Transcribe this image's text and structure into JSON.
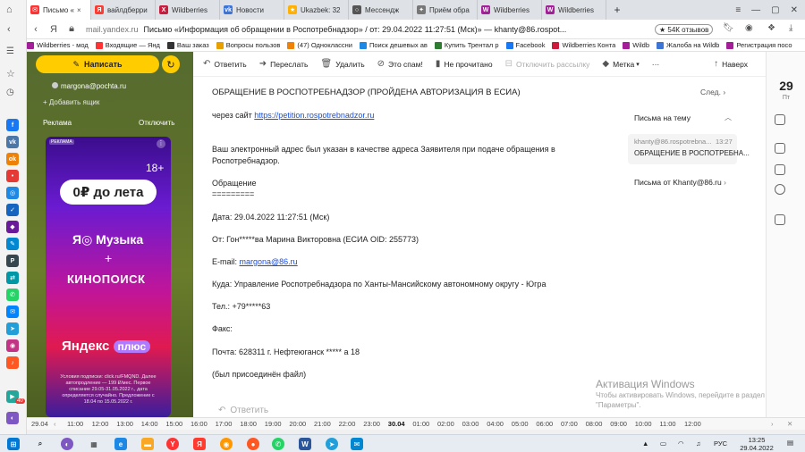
{
  "tabs": [
    {
      "label": "Письмо «",
      "color": "#ff3333",
      "icon": "mail-icon",
      "active": true
    },
    {
      "label": "вайлдберри",
      "color": "#ff3b30",
      "icon": "yandex-icon"
    },
    {
      "label": "Wildberries",
      "color": "#cb1b3c",
      "icon": "wb-icon"
    },
    {
      "label": "Новости",
      "color": "#3d75d6",
      "icon": "vk-icon"
    },
    {
      "label": "Ukazbek: 32",
      "color": "#ffb000",
      "icon": "ukazbek-icon"
    },
    {
      "label": "Мессендж",
      "color": "#555555",
      "icon": "messenger-icon"
    },
    {
      "label": "Приём обра",
      "color": "#777777",
      "icon": "gov-icon"
    },
    {
      "label": "Wildberries",
      "color": "#a31e98",
      "icon": "wb-icon"
    },
    {
      "label": "Wildberries",
      "color": "#a31e98",
      "icon": "wb-icon"
    }
  ],
  "address": {
    "host": "mail.yandex.ru",
    "title": "Письмо «Информация об обращении в Роспотребнадзор» / от: 29.04.2022 11:27:51 (Мск)» — khanty@86.rospot...",
    "reviews": "★ 54К отзывов"
  },
  "bookmarks": [
    {
      "label": "Wildberries - мод",
      "color": "#a31e98"
    },
    {
      "label": "Входящие — Янд",
      "color": "#ff3333"
    },
    {
      "label": "Ваш заказ",
      "color": "#333333"
    },
    {
      "label": "Вопросы пользов",
      "color": "#e8a000"
    },
    {
      "label": "(47) Одноклассни",
      "color": "#ee8208"
    },
    {
      "label": "Поиск дешевых ав",
      "color": "#1e88e5"
    },
    {
      "label": "Купить Трентал р",
      "color": "#2e7d32"
    },
    {
      "label": "Facebook",
      "color": "#1877f2"
    },
    {
      "label": "Wildberries Конта",
      "color": "#cb1b3c"
    },
    {
      "label": "Wildb",
      "color": "#a31e98"
    },
    {
      "label": "Жалоба на Wildb",
      "color": "#3d75d6"
    },
    {
      "label": "Регистрация посо",
      "color": "#a31e98"
    }
  ],
  "sidebar_left": {
    "email": "margona@pochta.ru",
    "add_box": "Добавить ящик",
    "ad_label": "Реклама",
    "ad_off": "Отключить"
  },
  "ad": {
    "badge": "РЕКЛАМА",
    "age": "18+",
    "promo": "0₽ до лета",
    "music": "Музыка",
    "plus": "+",
    "kino": "КИНОПОИСК",
    "yandex": "Яндекс",
    "plus_word": "плюс",
    "fine_print": "Условия подписки: click.ru/FMQND. Далее автопродление — 199 ₽/мес. Первое списание 29.05-31.05.2022 г., дата определяется случайно. Предложение с 18.04 по 15.05.2022 г."
  },
  "compose": {
    "label": "Написать"
  },
  "toolbar": {
    "reply": "Ответить",
    "forward": "Переслать",
    "delete": "Удалить",
    "spam": "Это спам!",
    "unread": "Не прочитано",
    "unsubscribe": "Отключить рассылку",
    "label": "Метка",
    "more": "···",
    "up": "Наверх"
  },
  "message": {
    "subject": "ОБРАЩЕНИЕ В РОСПОТРЕБНАДЗОР (ПРОЙДЕНА АВТОРИЗАЦИЯ В ЕСИА)",
    "next": "След.",
    "via_prefix": "через сайт ",
    "via_link": "https://petition.rospotrebnadzor.ru",
    "notice_1": "Ваш электронный адрес был указан в качестве адреса Заявителя при подаче обращения в",
    "notice_2": "Роспотребнадзор.",
    "section": "Обращение",
    "rule": "=========",
    "date": "Дата: 29.04.2022 11:27:51 (Мск)",
    "from": "От: Гон*****ва Марина Викторовна (ЕСИА OID: 255773)",
    "email_prefix": "E-mail: ",
    "email_link": "margona@86.ru",
    "to": "Куда: Управление Роспотребнадзора по Ханты-Мансийскому автономному округу - Югра",
    "phone": "Тел.: +79*****63",
    "fax": "Факс:",
    "post": "Почта: 628311 г. Нефтеюганск ***** а 18",
    "attachment": "(был присоединён файл)"
  },
  "thread": {
    "title": "Письма на тему",
    "item_from": "khanty@86.rospotrebna...",
    "item_time": "13:27",
    "item_subject": "ОБРАЩЕНИЕ В РОСПОТРЕБНА...",
    "from_khanty": "Письма от Khanty@86.ru"
  },
  "rail": {
    "day": "29",
    "weekday": "Пт"
  },
  "reply_bar": {
    "label": "Ответить"
  },
  "watermark": {
    "line1": "Активация Windows",
    "line2": "Чтобы активировать Windows, перейдите в раздел",
    "line3": "\"Параметры\"."
  },
  "timeline": {
    "date_label": "29.04",
    "ticks": [
      "11:00",
      "12:00",
      "13:00",
      "14:00",
      "15:00",
      "16:00",
      "17:00",
      "18:00",
      "19:00",
      "20:00",
      "21:00",
      "22:00",
      "23:00",
      "30.04",
      "01:00",
      "02:00",
      "03:00",
      "04:00",
      "05:00",
      "06:00",
      "07:00",
      "08:00",
      "09:00",
      "10:00",
      "11:00",
      "12:00"
    ]
  },
  "taskbar": {
    "lang": "РУС",
    "time": "13:25",
    "date": "29.04.2022"
  },
  "sidebar_badge": "40"
}
